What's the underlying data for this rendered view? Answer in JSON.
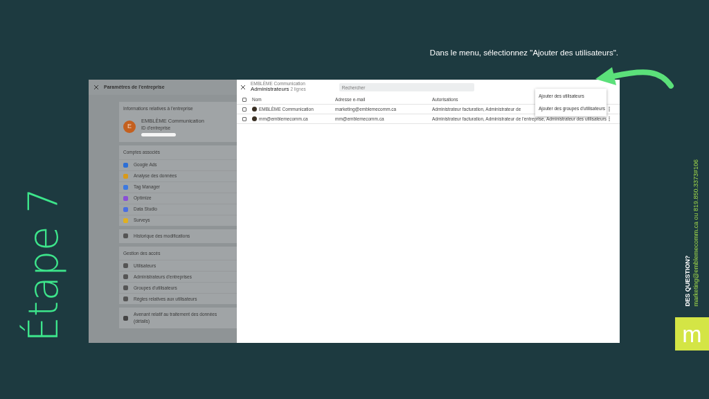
{
  "step_title": "Étape 7",
  "instruction": "Dans le menu, sélectionnez \"Ajouter des utilisateurs\".",
  "contact": {
    "heading": "DES QUESTION?",
    "details": "marketing@emblemecomm.ca ou 819.850.3373#106",
    "logo_letter": "m"
  },
  "background_page": {
    "title": "Paramètres de l'entreprise",
    "account_card": {
      "heading": "Informations relatives à l'entreprise",
      "avatar": "E",
      "name": "EMBLÈME Communication",
      "subtitle": "ID d'entreprise"
    },
    "linked_accounts": {
      "heading": "Comptes associés",
      "items": [
        "Google Ads",
        "Analyse des données",
        "Tag Manager",
        "Optimize",
        "Data Studio",
        "Surveys"
      ]
    },
    "history": "Historique des modifications",
    "access": {
      "heading": "Gestion des accès",
      "items": [
        "Utilisateurs",
        "Administrateurs d'entreprises",
        "Groupes d'utilisateurs",
        "Règles relatives aux utilisateurs"
      ]
    },
    "notice": "Avenant relatif au traitement des données (détails)"
  },
  "panel": {
    "breadcrumb": "EMBLÈME Communication",
    "title": "Administrateurs",
    "count": "2 lignes",
    "search": {
      "placeholder": "Rechercher"
    },
    "columns": [
      "Nom",
      "Adresse e-mail",
      "Autorisations"
    ],
    "all_selected": false,
    "rows": [
      {
        "checked": false,
        "name": "EMBLÈME Communication",
        "email": "marketing@emblemecomm.ca",
        "permissions": "Administrateur facturation, Administrateur de"
      },
      {
        "checked": false,
        "name": "mm@emblemecomm.ca",
        "email": "mm@emblemecomm.ca",
        "permissions": "Administrateur facturation, Administrateur de l'entreprise, Administrateur des utilisateurs"
      }
    ]
  },
  "menu": {
    "items": [
      "Ajouter des utilisateurs",
      "Ajouter des groupes d'utilisateurs"
    ]
  }
}
